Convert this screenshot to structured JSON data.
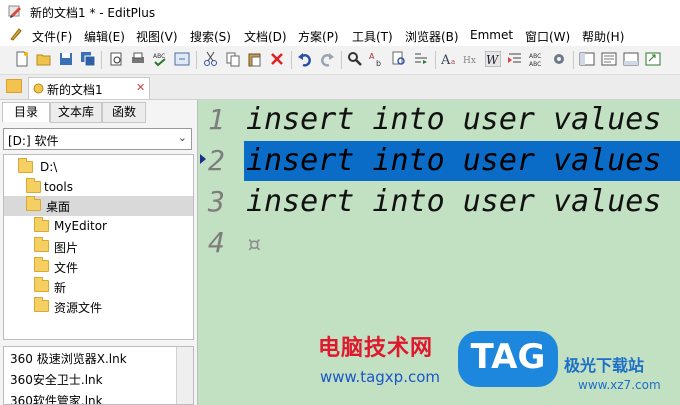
{
  "window": {
    "title": "新的文档1 * - EditPlus"
  },
  "menubar": {
    "items": [
      "文件(F)",
      "编辑(E)",
      "视图(V)",
      "搜索(S)",
      "文档(D)",
      "方案(P)",
      "工具(T)",
      "浏览器(B)",
      "Emmet",
      "窗口(W)",
      "帮助(H)"
    ]
  },
  "tabs": {
    "document": "新的文档1",
    "close_glyph": "✕"
  },
  "sidebar": {
    "tabs": [
      "目录",
      "文本库",
      "函数"
    ],
    "drive": "[D:] 软件",
    "tree": [
      "D:\\",
      "tools",
      "桌面",
      "MyEditor",
      "图片",
      "文件",
      "新",
      "资源文件"
    ],
    "files": [
      "360 极速浏览器X.lnk",
      "360安全卫士.lnk",
      "360软件管家.lnk"
    ]
  },
  "editor": {
    "line_numbers": [
      "1",
      "2",
      "3",
      "4"
    ],
    "lines": [
      "insert into user values",
      "insert into user values",
      "insert into user values"
    ],
    "eol_glyph": "¤",
    "selected_line": 2
  },
  "watermark": {
    "site_cn": "电脑技术网",
    "site_url": "www.tagxp.com",
    "badge": "TAG",
    "brand_cn": "极光下载站",
    "brand_url": "www.xz7.com"
  },
  "colors": {
    "editor_bg": "#c2e0c2",
    "selection": "#0b6cc8",
    "watermark_red": "#e0182d",
    "watermark_blue": "#1c87dc"
  }
}
